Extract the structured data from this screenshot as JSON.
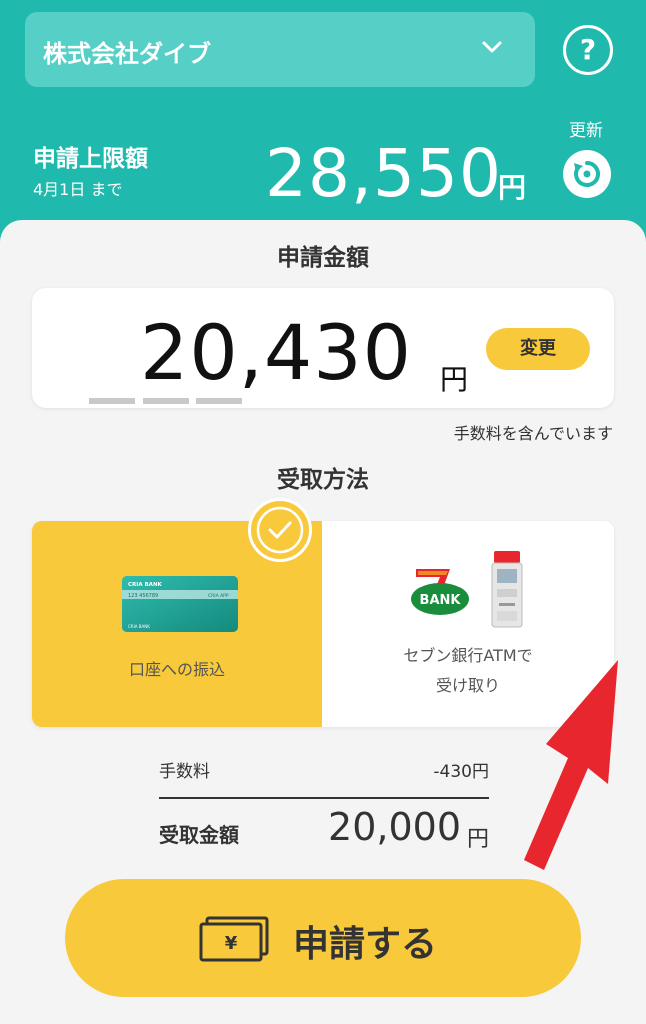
{
  "header": {
    "company": "株式会社ダイブ",
    "help_label": "?",
    "limit_label": "申請上限額",
    "limit_date": "4月1日 まで",
    "limit_amount": "28,550",
    "currency": "円",
    "refresh_label": "更新"
  },
  "request": {
    "title": "申請金額",
    "amount": "20,430",
    "currency": "円",
    "change_label": "変更",
    "fee_note": "手数料を含んでいます"
  },
  "receive": {
    "title": "受取方法",
    "methods": [
      {
        "label": "口座への振込",
        "selected": true,
        "card_bank": "CRIA BANK",
        "card_number": "123   456789",
        "card_app": "CRIA APP",
        "card_footer": "CRIA BANK"
      },
      {
        "label_line1": "セブン銀行ATMで",
        "label_line2": "受け取り",
        "selected": false,
        "logo_text": "BANK"
      }
    ]
  },
  "summary": {
    "fee_label": "手数料",
    "fee_value": "-430円",
    "receive_label": "受取金額",
    "receive_value": "20,000",
    "currency": "円"
  },
  "apply": {
    "label": "申請する",
    "icon_glyph": "¥"
  },
  "colors": {
    "header_bg": "#1fb9ad",
    "accent_yellow": "#f8c93b",
    "arrow_red": "#e8262d"
  },
  "icons": [
    "chevron-down-icon",
    "help-icon",
    "refresh-icon",
    "check-icon",
    "bank-card-icon",
    "seven-bank-logo-icon",
    "atm-machine-icon",
    "cash-yen-icon",
    "red-arrow-annotation"
  ]
}
